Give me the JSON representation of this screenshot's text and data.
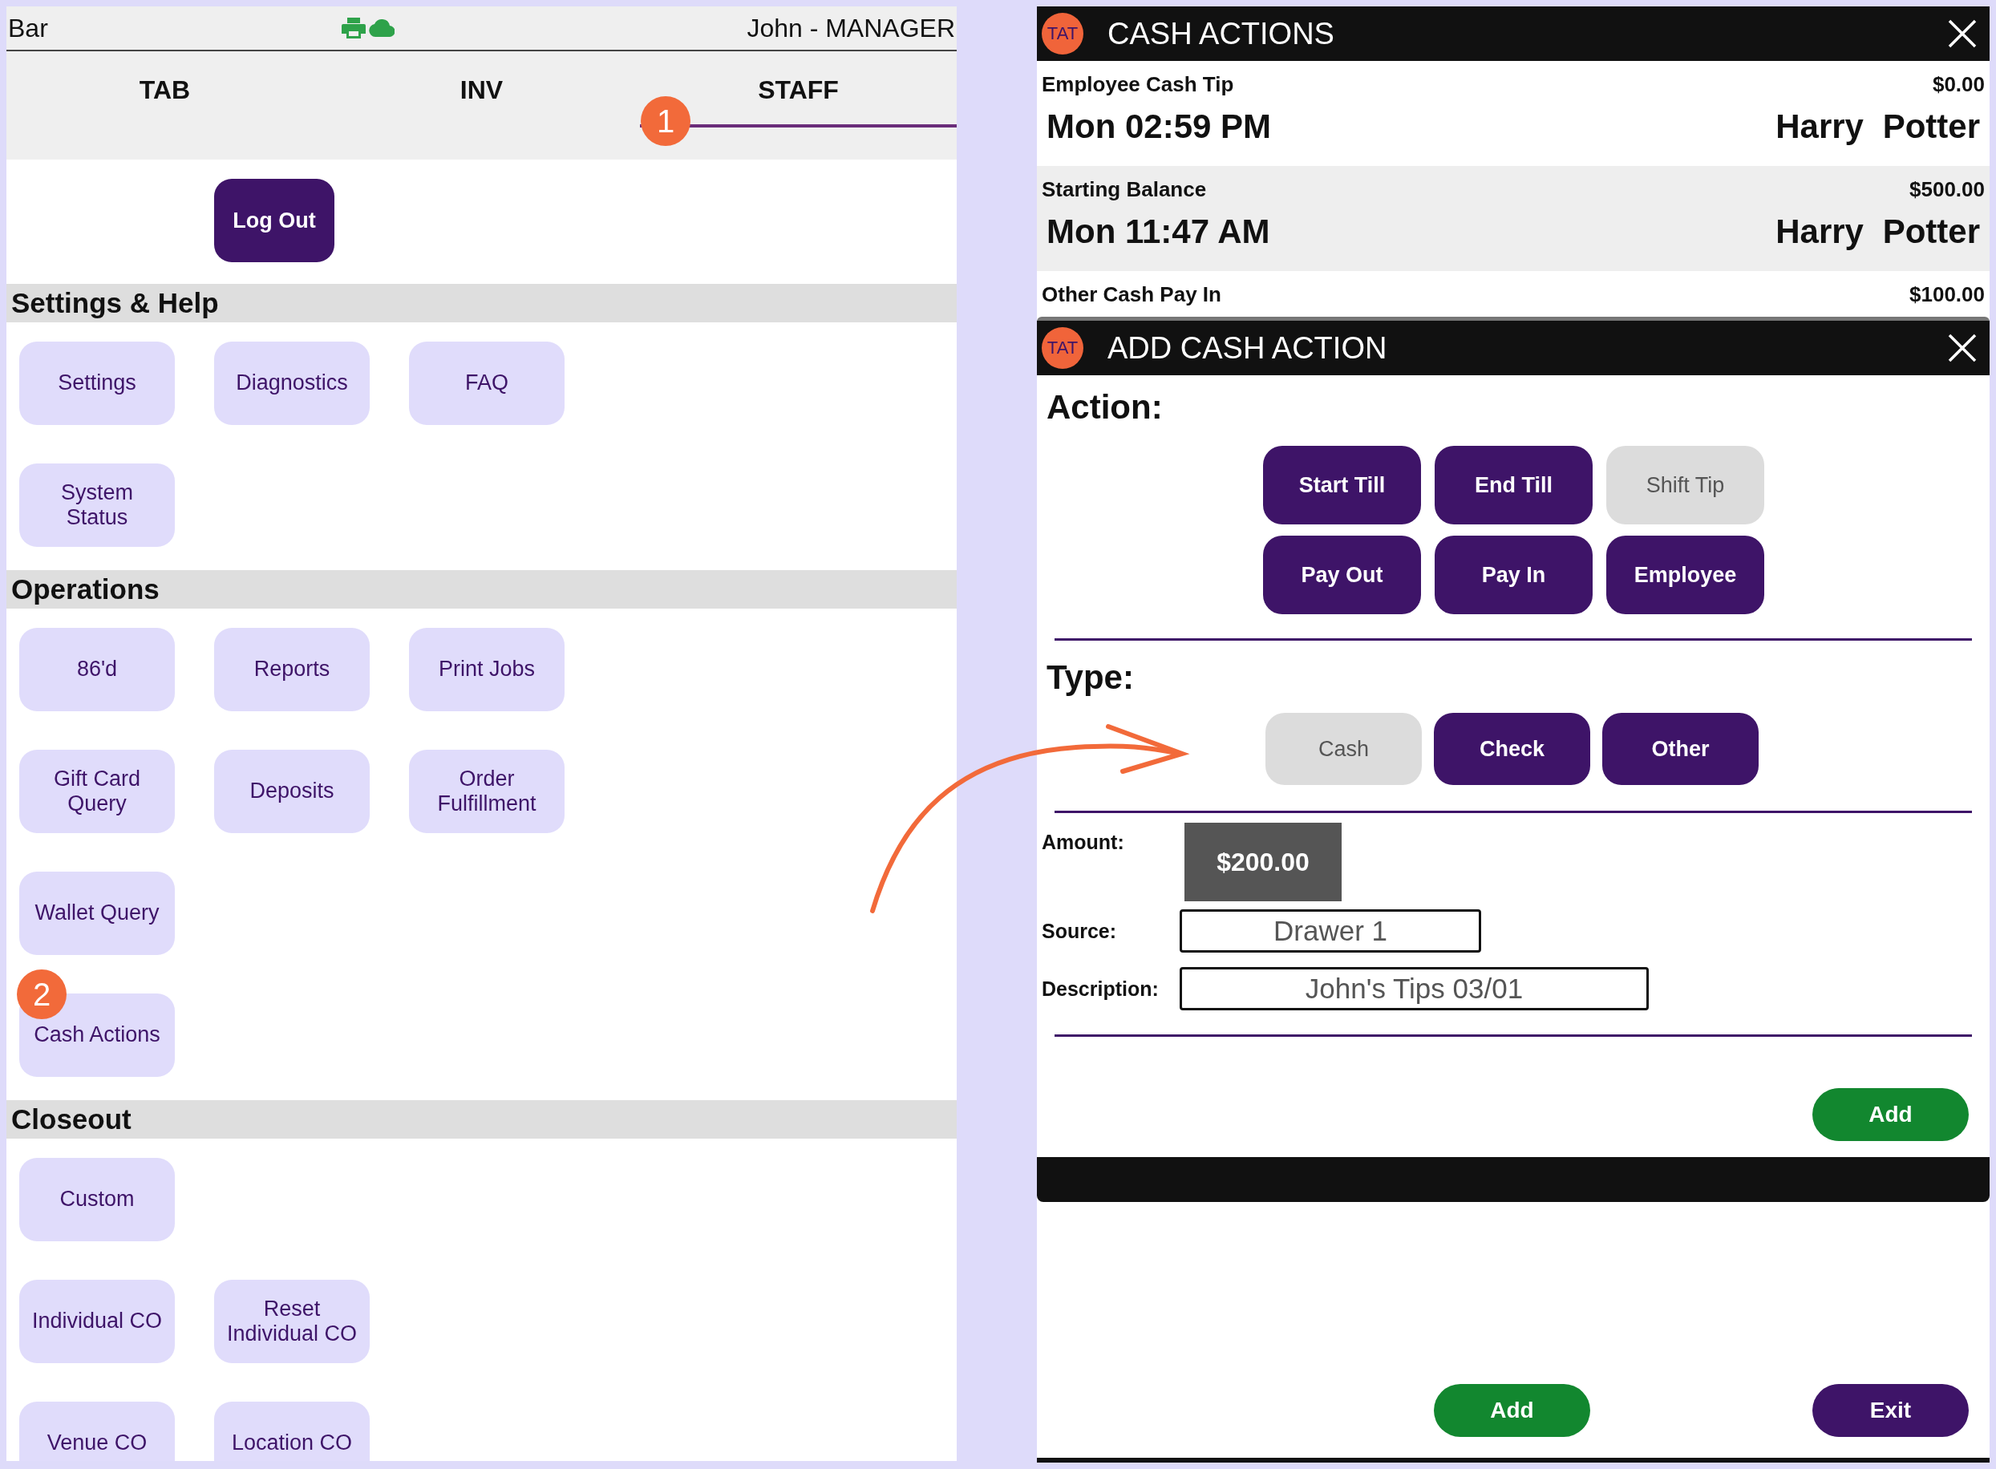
{
  "staff_screen": {
    "header": {
      "location": "Bar",
      "user": "John - MANAGER"
    },
    "tabs": [
      {
        "label": "TAB",
        "selected": false
      },
      {
        "label": "INV",
        "selected": false
      },
      {
        "label": "STAFF",
        "selected": true
      }
    ],
    "logout_button": "Log Out",
    "sections": [
      {
        "title": "Settings & Help",
        "rows": [
          [
            "Settings",
            "Diagnostics",
            "FAQ"
          ],
          [
            "System\nStatus"
          ]
        ]
      },
      {
        "title": "Operations",
        "rows": [
          [
            "86'd",
            "Reports",
            "Print Jobs"
          ],
          [
            "Gift Card\nQuery",
            "Deposits",
            "Order\nFulfillment"
          ],
          [
            "Wallet Query"
          ],
          [
            "Cash Actions"
          ]
        ]
      },
      {
        "title": "Closeout",
        "rows": [
          [
            "Custom"
          ],
          [
            "Individual CO",
            "Reset\nIndividual CO"
          ],
          [
            "Venue CO",
            "Location CO"
          ]
        ]
      }
    ]
  },
  "cash_actions": {
    "logo": "TAT",
    "title": "CASH ACTIONS",
    "entries": [
      {
        "label": "Employee Cash Tip",
        "amount": "$0.00",
        "time": "Mon 02:59 PM",
        "employee": "Harry Potter"
      },
      {
        "label": "Starting Balance",
        "amount": "$500.00",
        "time": "Mon 11:47 AM",
        "employee": "Harry Potter"
      },
      {
        "label": "Other Cash Pay In",
        "amount": "$100.00"
      }
    ]
  },
  "add_cash_action": {
    "logo": "TAT",
    "title": "ADD CASH ACTION",
    "action_label": "Action:",
    "actions": [
      {
        "label": "Start Till",
        "selected": false
      },
      {
        "label": "End Till",
        "selected": false
      },
      {
        "label": "Shift Tip",
        "selected": true
      },
      {
        "label": "Pay Out",
        "selected": false
      },
      {
        "label": "Pay In",
        "selected": false
      },
      {
        "label": "Employee",
        "selected": false
      }
    ],
    "type_label": "Type:",
    "types": [
      {
        "label": "Cash",
        "selected": true
      },
      {
        "label": "Check",
        "selected": false
      },
      {
        "label": "Other",
        "selected": false
      }
    ],
    "fields": [
      {
        "kind": "amount",
        "label": "Amount:",
        "value": "$200.00"
      },
      {
        "kind": "source",
        "label": "Source:",
        "value": "Drawer 1"
      },
      {
        "kind": "description",
        "label": "Description:",
        "value": "John's Tips 03/01"
      }
    ],
    "add_button": "Add",
    "footer_buttons": [
      {
        "kind": "confirm",
        "label": "Add"
      },
      {
        "kind": "exit",
        "label": "Exit"
      }
    ]
  },
  "annotations": [
    {
      "kind": "badge",
      "label": "1"
    },
    {
      "kind": "badge",
      "label": "2"
    },
    {
      "kind": "arrow"
    }
  ]
}
